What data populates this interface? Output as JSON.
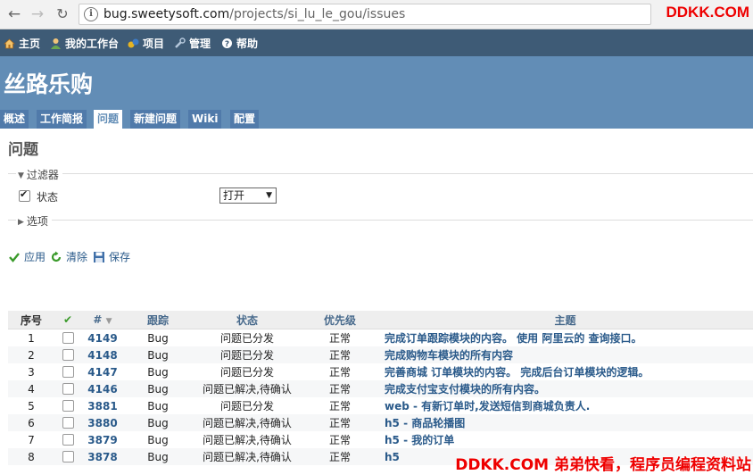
{
  "browser": {
    "url_host": "bug.sweetysoft.com",
    "url_path": "/projects/si_lu_le_gou/issues",
    "watermark": "DDKK.COM"
  },
  "top_menu": {
    "home": "主页",
    "my_page": "我的工作台",
    "projects": "项目",
    "admin": "管理",
    "help": "帮助"
  },
  "header": {
    "title": "丝路乐购"
  },
  "tabs": [
    {
      "label": "概述"
    },
    {
      "label": "工作简报"
    },
    {
      "label": "问题"
    },
    {
      "label": "新建问题"
    },
    {
      "label": "Wiki"
    },
    {
      "label": "配置"
    }
  ],
  "page": {
    "title": "问题",
    "filters_legend": "过滤器",
    "status_label": "状态",
    "status_value": "打开",
    "options_legend": "选项",
    "apply": "应用",
    "clear": "清除",
    "save": "保存"
  },
  "table": {
    "headers": {
      "index": "序号",
      "check": "✔",
      "id": "#",
      "tracker": "跟踪",
      "status": "状态",
      "priority": "优先级",
      "subject": "主题"
    },
    "rows": [
      {
        "n": "1",
        "id": "4149",
        "tracker": "Bug",
        "status": "问题已分发",
        "priority": "正常",
        "subject": "完成订单跟踪模块的内容。 使用 阿里云的 查询接口。"
      },
      {
        "n": "2",
        "id": "4148",
        "tracker": "Bug",
        "status": "问题已分发",
        "priority": "正常",
        "subject": "完成购物车模块的所有内容"
      },
      {
        "n": "3",
        "id": "4147",
        "tracker": "Bug",
        "status": "问题已分发",
        "priority": "正常",
        "subject": "完善商城 订单模块的内容。 完成后台订单模块的逻辑。"
      },
      {
        "n": "4",
        "id": "4146",
        "tracker": "Bug",
        "status": "问题已解决,待确认",
        "priority": "正常",
        "subject": "完成支付宝支付模块的所有内容。"
      },
      {
        "n": "5",
        "id": "3881",
        "tracker": "Bug",
        "status": "问题已分发",
        "priority": "正常",
        "subject": "web - 有新订单时,发送短信到商城负责人."
      },
      {
        "n": "6",
        "id": "3880",
        "tracker": "Bug",
        "status": "问题已解决,待确认",
        "priority": "正常",
        "subject": "h5 - 商品轮播图"
      },
      {
        "n": "7",
        "id": "3879",
        "tracker": "Bug",
        "status": "问题已解决,待确认",
        "priority": "正常",
        "subject": "h5 - 我的订单"
      },
      {
        "n": "8",
        "id": "3878",
        "tracker": "Bug",
        "status": "问题已解决,待确认",
        "priority": "正常",
        "subject": "h5"
      }
    ]
  },
  "watermark_bottom": "DDKK.COM 弟弟快看，程序员编程资料站"
}
